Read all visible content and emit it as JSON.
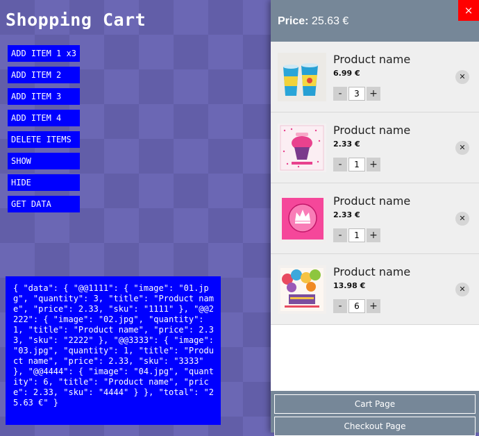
{
  "page": {
    "title": "Shopping Cart"
  },
  "controls": [
    "ADD ITEM 1 x3",
    "ADD ITEM 2",
    "ADD ITEM 3",
    "ADD ITEM 4",
    "DELETE ITEMS",
    "SHOW",
    "HIDE",
    "GET DATA"
  ],
  "data_output": "{ \"data\": { \"@@1111\": { \"image\": \"01.jpg\", \"quantity\": 3, \"title\": \"Product name\", \"price\": 2.33, \"sku\": \"1111\" }, \"@@2222\": { \"image\": \"02.jpg\", \"quantity\": 1, \"title\": \"Product name\", \"price\": 2.33, \"sku\": \"2222\" }, \"@@3333\": { \"image\": \"03.jpg\", \"quantity\": 1, \"title\": \"Product name\", \"price\": 2.33, \"sku\": \"3333\" }, \"@@4444\": { \"image\": \"04.jpg\", \"quantity\": 6, \"title\": \"Product name\", \"price\": 2.33, \"sku\": \"4444\" } }, \"total\": \"25.63 €\" }",
  "cart": {
    "price_label": "Price:",
    "price_value": "25.63 €",
    "close_symbol": "×",
    "remove_symbol": "✕",
    "minus": "-",
    "plus": "+",
    "items": [
      {
        "title": "Product name",
        "price": "6.99 €",
        "quantity": "3",
        "image": "paper-cups"
      },
      {
        "title": "Product name",
        "price": "2.33 €",
        "quantity": "1",
        "image": "cupcake-napkin"
      },
      {
        "title": "Product name",
        "price": "2.33 €",
        "quantity": "1",
        "image": "pink-crown-napkin"
      },
      {
        "title": "Product name",
        "price": "13.98 €",
        "quantity": "6",
        "image": "birthday-balloons-napkin"
      }
    ],
    "cart_page_label": "Cart Page",
    "checkout_page_label": "Checkout Page"
  },
  "colors": {
    "button_blue": "#0000ff",
    "panel_header": "#768798",
    "close_red": "#ff0000"
  }
}
